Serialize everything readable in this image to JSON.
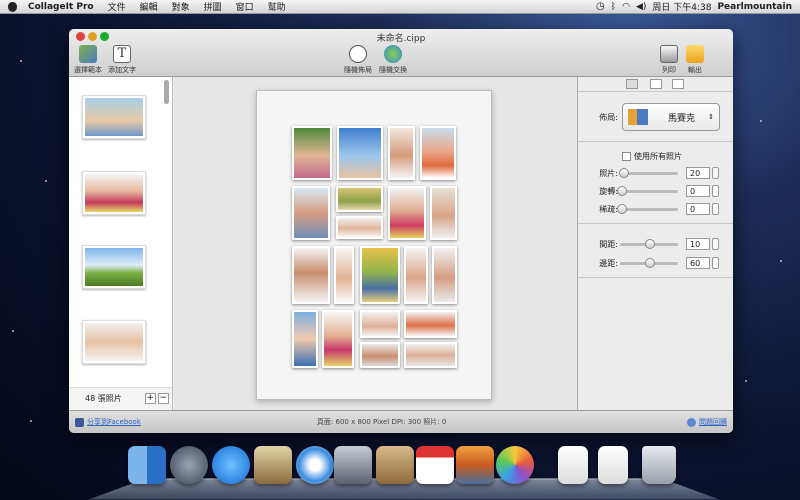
{
  "menubar": {
    "app_name": "CollageIt Pro",
    "items": [
      "文件",
      "編輯",
      "對象",
      "拼圖",
      "窗口",
      "幫助"
    ],
    "clock": "周日 下午4:38",
    "user": "Pearlmountain"
  },
  "window": {
    "title": "未命名.cipp",
    "toolbar": {
      "select_template": "選擇範本",
      "add_text": "添加文字",
      "random_layout": "隨機佈局",
      "random_swap": "隨機交換",
      "print": "列印",
      "export": "輸出"
    }
  },
  "sidebar": {
    "photo_count": "48 張照片",
    "add_label": "+",
    "remove_label": "−"
  },
  "panel": {
    "layout_label": "佈局:",
    "layout_value": "馬賽克",
    "use_all_photos": "使用所有照片",
    "photos_label": "照片:",
    "photos_value": "20",
    "rotate_label": "旋轉:",
    "rotate_value": "0",
    "fill_label": "稀疏:",
    "fill_value": "0",
    "spacing_label": "間距:",
    "spacing_value": "10",
    "margin_label": "邊距:",
    "margin_value": "60"
  },
  "status": {
    "share": "分享到Facebook",
    "page_info": "頁面: 600 x 800 Pixel  DPI: 300  照片: 0",
    "feedback": "問題回饋"
  },
  "colors": {
    "accent": "#2a63c9",
    "close": "#e0443e",
    "minimize": "#dea123",
    "zoom": "#1aab29"
  }
}
